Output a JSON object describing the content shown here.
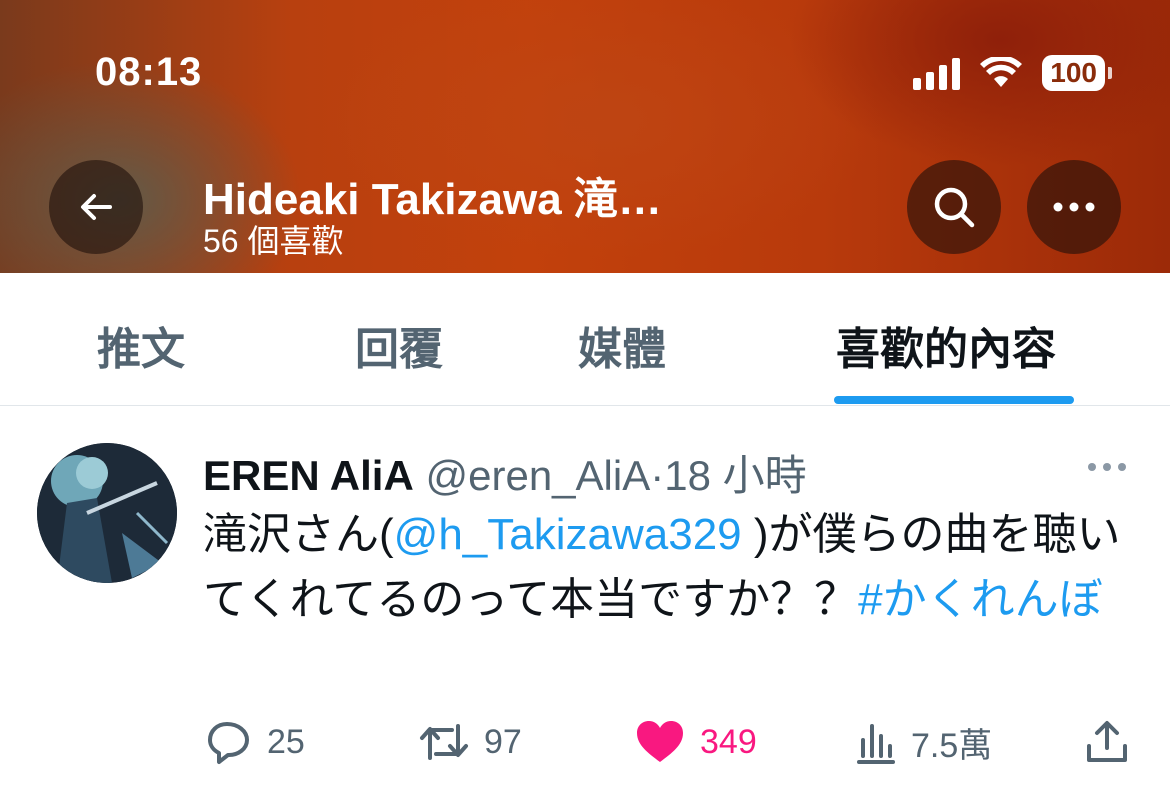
{
  "status_bar": {
    "time": "08:13",
    "battery": "100"
  },
  "header": {
    "title": "Hideaki Takizawa 滝…",
    "subtitle": "56 個喜歡"
  },
  "tabs": [
    {
      "label": "推文"
    },
    {
      "label": "回覆"
    },
    {
      "label": "媒體"
    },
    {
      "label": "喜歡的內容"
    }
  ],
  "tweet": {
    "author": "EREN AliA",
    "handle": "@eren_AliA",
    "separator": "·",
    "time": "18 小時",
    "text_part1": "滝沢さん(",
    "mention": "@h_Takizawa329",
    "text_part2": " )が僕らの曲を聴いてくれてるのって本当ですか？？",
    "hashtag": "#かくれんぼ",
    "replies": "25",
    "retweets": "97",
    "likes": "349",
    "views": "7.5萬"
  },
  "colors": {
    "accent": "#1d9bf0",
    "like": "#f91880",
    "muted": "#536471",
    "header_bg": "#b8400f"
  },
  "icons": [
    "back-arrow-icon",
    "search-icon",
    "more-icon",
    "reply-icon",
    "retweet-icon",
    "heart-icon",
    "views-icon",
    "share-icon"
  ]
}
